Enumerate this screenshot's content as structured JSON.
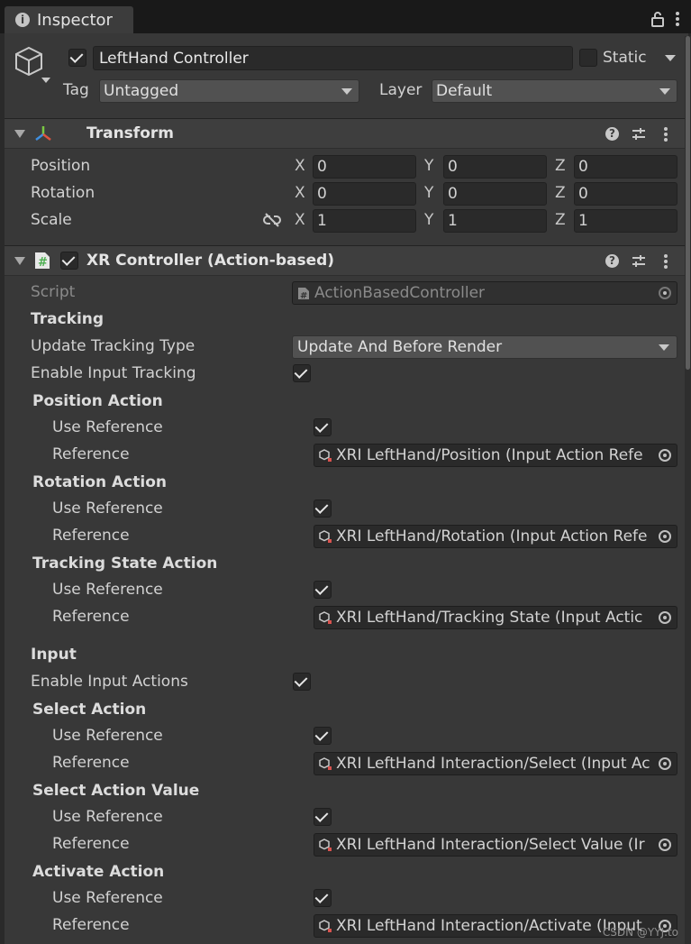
{
  "tab": {
    "title": "Inspector"
  },
  "object": {
    "name": "LeftHand Controller",
    "static_label": "Static",
    "tag_label": "Tag",
    "tag_value": "Untagged",
    "layer_label": "Layer",
    "layer_value": "Default"
  },
  "transform": {
    "title": "Transform",
    "rows": [
      {
        "label": "Position",
        "x": "0",
        "y": "0",
        "z": "0"
      },
      {
        "label": "Rotation",
        "x": "0",
        "y": "0",
        "z": "0"
      },
      {
        "label": "Scale",
        "x": "1",
        "y": "1",
        "z": "1"
      }
    ],
    "axis": {
      "x": "X",
      "y": "Y",
      "z": "Z"
    }
  },
  "xr": {
    "title": "XR Controller (Action-based)",
    "script_label": "Script",
    "script_value": "ActionBasedController",
    "tracking_header": "Tracking",
    "update_tracking_type_label": "Update Tracking Type",
    "update_tracking_type_value": "Update And Before Render",
    "enable_input_tracking_label": "Enable Input Tracking",
    "input_header": "Input",
    "enable_input_actions_label": "Enable Input Actions",
    "use_reference_label": "Use Reference",
    "reference_label": "Reference",
    "actions": [
      {
        "title": "Position Action",
        "reference": "XRI LeftHand/Position (Input Action Refe"
      },
      {
        "title": "Rotation Action",
        "reference": "XRI LeftHand/Rotation (Input Action Refe"
      },
      {
        "title": "Tracking State Action",
        "reference": "XRI LeftHand/Tracking State (Input Actic"
      },
      {
        "title": "Select Action",
        "reference": "XRI LeftHand Interaction/Select (Input Ac"
      },
      {
        "title": "Select Action Value",
        "reference": "XRI LeftHand Interaction/Select Value (Ir"
      },
      {
        "title": "Activate Action",
        "reference": "XRI LeftHand Interaction/Activate (Input"
      }
    ]
  },
  "watermark": "CSDN @YYJ.to",
  "colors": {
    "panel_bg": "#383838",
    "header_bg": "#3e3e3e",
    "field_bg": "#2a2a2a",
    "script_icon_green": "#4caf50"
  }
}
